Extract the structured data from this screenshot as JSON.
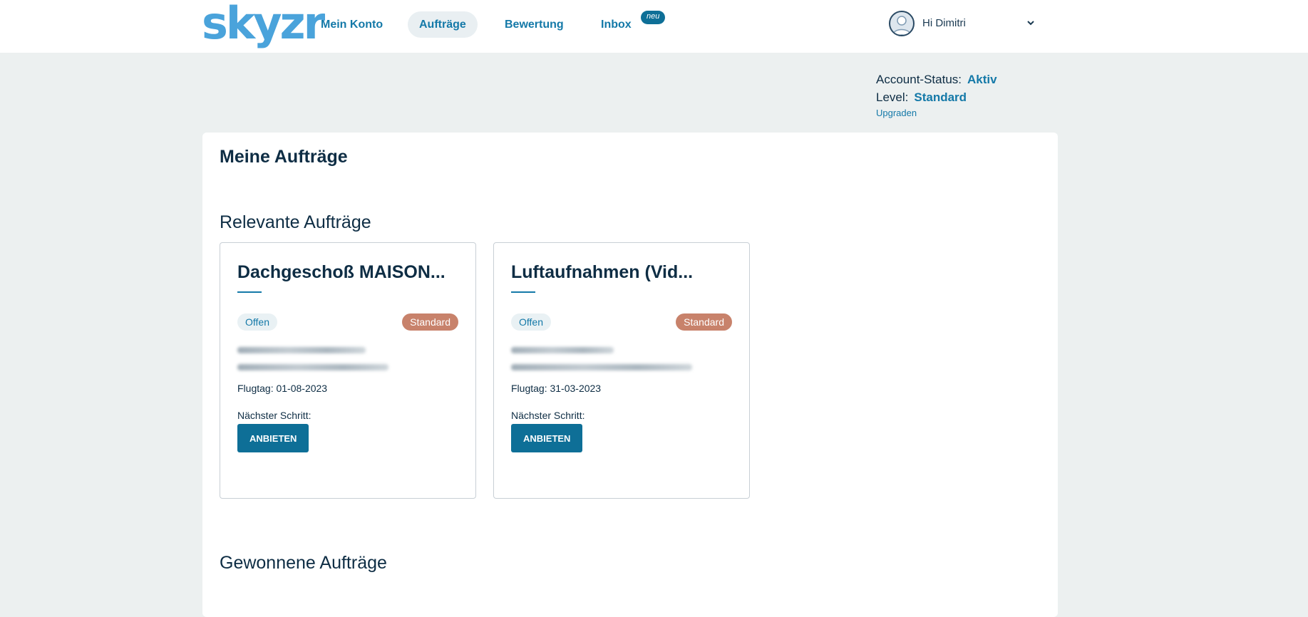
{
  "header": {
    "logo": "skyzr",
    "nav": [
      {
        "label": "Mein Konto",
        "active": false
      },
      {
        "label": "Aufträge",
        "active": true
      },
      {
        "label": "Bewertung",
        "active": false
      },
      {
        "label": "Inbox",
        "active": false
      }
    ],
    "inbox_badge": "neu",
    "user_greeting": "Hi Dimitri"
  },
  "account": {
    "status_label": "Account-Status:",
    "status_value": "Aktiv",
    "level_label": "Level:",
    "level_value": "Standard",
    "upgrade_link": "Upgraden"
  },
  "main": {
    "title": "Meine Aufträge",
    "relevant_title": "Relevante Aufträge",
    "won_title": "Gewonnene Aufträge",
    "cards": [
      {
        "title": "Dachgeschoß MAISON...",
        "status": "Offen",
        "level": "Standard",
        "date": "Flugtag: 01-08-2023",
        "next_step_label": "Nächster Schritt:",
        "button": "ANBIETEN"
      },
      {
        "title": "Luftaufnahmen (Vid...",
        "status": "Offen",
        "level": "Standard",
        "date": "Flugtag: 31-03-2023",
        "next_step_label": "Nächster Schritt:",
        "button": "ANBIETEN"
      }
    ]
  },
  "colors": {
    "brand_blue": "#1479a8",
    "logo_blue": "#4aa3db",
    "level_badge": "#c8826b",
    "page_bg": "#ecf0f0"
  }
}
